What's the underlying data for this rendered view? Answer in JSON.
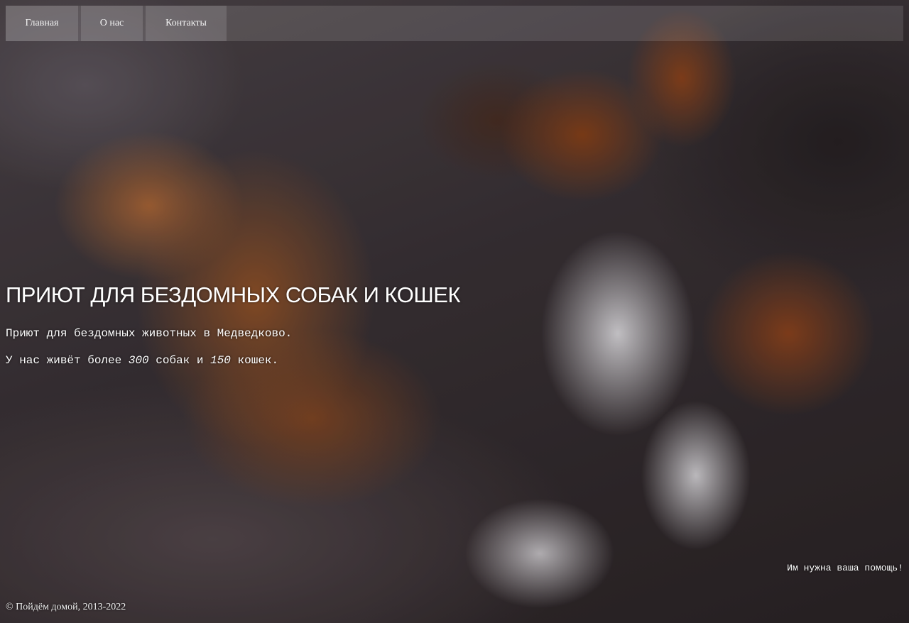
{
  "nav": {
    "items": [
      {
        "label": "Главная"
      },
      {
        "label": "О нас"
      },
      {
        "label": "Контакты"
      }
    ]
  },
  "hero": {
    "title": "ПРИЮТ ДЛЯ БЕЗДОМНЫХ СОБАК И КОШЕК",
    "intro": "Приют для бездомных животных в Медведково.",
    "stats_prefix": "У нас живёт более",
    "dogs_count": "300",
    "stats_middle": "собак и",
    "cats_count": "150",
    "stats_suffix": "кошек.",
    "help": "Им нужна ваша помощь!"
  },
  "footer": {
    "copyright": "© Пойдём домой, 2013-2022"
  }
}
